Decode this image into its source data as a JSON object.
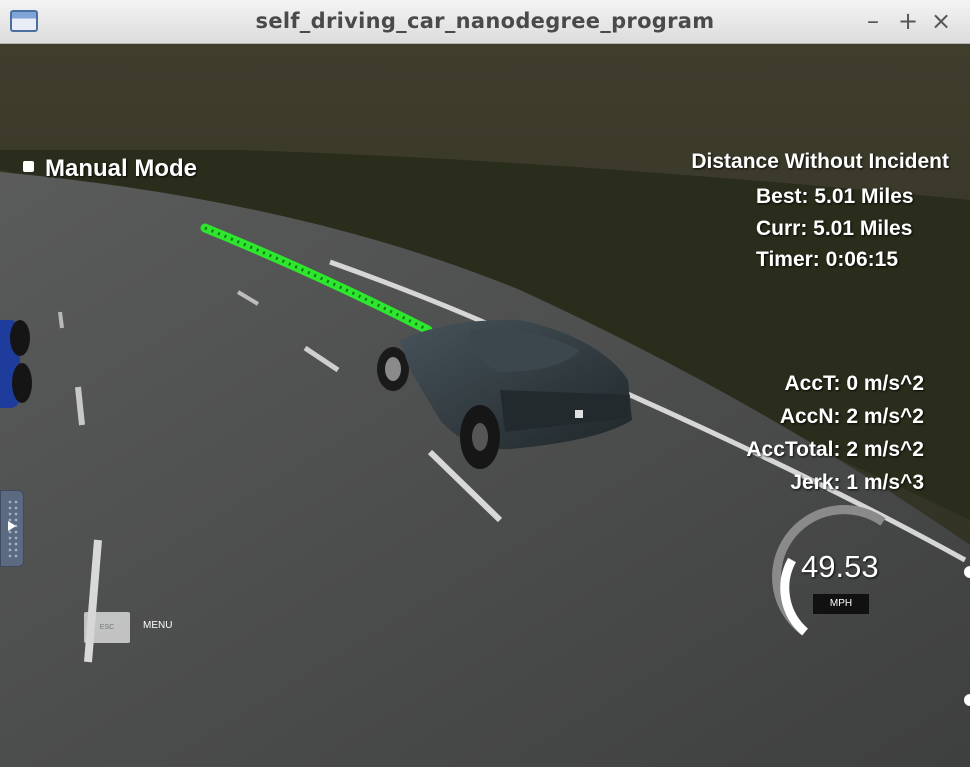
{
  "window": {
    "title": "self_driving_car_nanodegree_program",
    "controls": [
      "–",
      "+",
      "×"
    ]
  },
  "hud": {
    "mode": "Manual Mode",
    "distance": {
      "title": "Distance Without Incident",
      "best": "Best: 5.01 Miles",
      "curr": "Curr: 5.01 Miles",
      "timer": "Timer: 0:06:15"
    },
    "dynamics": {
      "acc_t": "AccT: 0 m/s^2",
      "acc_n": "AccN: 2 m/s^2",
      "acc_total": "AccTotal: 2 m/s^2",
      "jerk": "Jerk: 1 m/s^3"
    },
    "speedometer": {
      "value": "49.53",
      "unit": "MPH",
      "gauge_fraction": 0.55
    },
    "esc_label": "ESC",
    "menu_label": "MENU"
  },
  "colors": {
    "path_green": "#2ee62e",
    "road": "#4e4f4f",
    "grass": "#2c2f1d",
    "car_body": "#2f373b"
  }
}
